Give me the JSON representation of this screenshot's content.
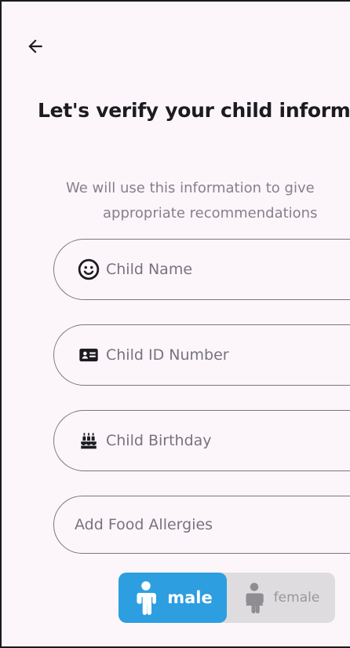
{
  "header": {
    "back_icon": "arrow-left-icon"
  },
  "title": "Let's verify your child inform",
  "subtitle": {
    "line1": "We will use this information to give",
    "line2": "appropriate recommendations"
  },
  "form": {
    "child_name": {
      "placeholder": "Child Name",
      "icon": "face-icon"
    },
    "child_id": {
      "placeholder": "Child ID Number",
      "icon": "id-card-icon"
    },
    "child_birthday": {
      "placeholder": "Child Birthday",
      "icon": "cake-icon"
    },
    "food_allergies": {
      "placeholder": "Add Food Allergies"
    }
  },
  "gender": {
    "male_label": "male",
    "female_label": "female",
    "selected": "male",
    "selected_color": "#2d9ee0",
    "unselected_color": "#dedcde"
  }
}
